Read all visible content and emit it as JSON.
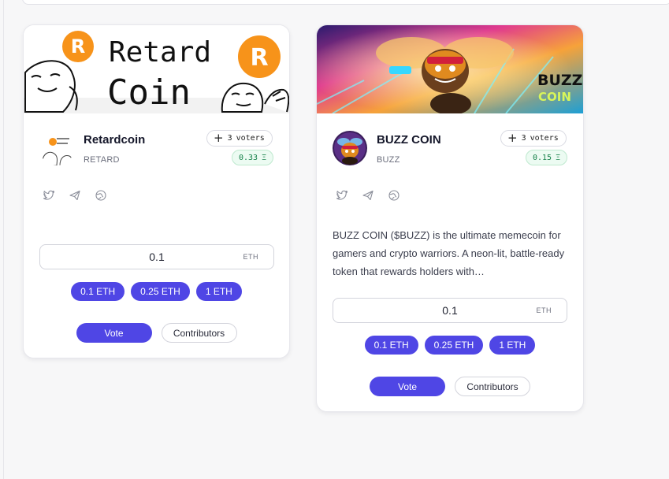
{
  "cards": [
    {
      "name": "Retardcoin",
      "symbol": "RETARD",
      "voters_count": "3",
      "voters_label": "voters",
      "eth_amount": "0.33",
      "eth_symbol": "Ξ",
      "banner_word_1": "Retard",
      "banner_word_2": "Coin",
      "banner_coin_mark": "R",
      "socials": [
        "twitter-icon",
        "telegram-icon",
        "website-icon"
      ],
      "amount_value": "0.1",
      "amount_unit": "ETH",
      "presets": [
        "0.1 ETH",
        "0.25 ETH",
        "1 ETH"
      ],
      "vote_label": "Vote",
      "contributors_label": "Contributors"
    },
    {
      "name": "BUZZ COIN",
      "symbol": "BUZZ",
      "voters_count": "3",
      "voters_label": "voters",
      "eth_amount": "0.15",
      "eth_symbol": "Ξ",
      "banner_word_1": "BUZZ",
      "banner_word_2": "COIN",
      "description": "BUZZ COIN ($BUZZ) is the ultimate memecoin for gamers and crypto warriors. A neon-lit, battle-ready token that rewards holders with…",
      "socials": [
        "twitter-icon",
        "telegram-icon",
        "website-icon"
      ],
      "amount_value": "0.1",
      "amount_unit": "ETH",
      "presets": [
        "0.1 ETH",
        "0.25 ETH",
        "1 ETH"
      ],
      "vote_label": "Vote",
      "contributors_label": "Contributors"
    }
  ],
  "colors": {
    "accent": "#4f46e5",
    "eth_badge_text": "#17824a",
    "eth_badge_bg": "#ecfbf2",
    "coin_orange": "#f7931a"
  }
}
